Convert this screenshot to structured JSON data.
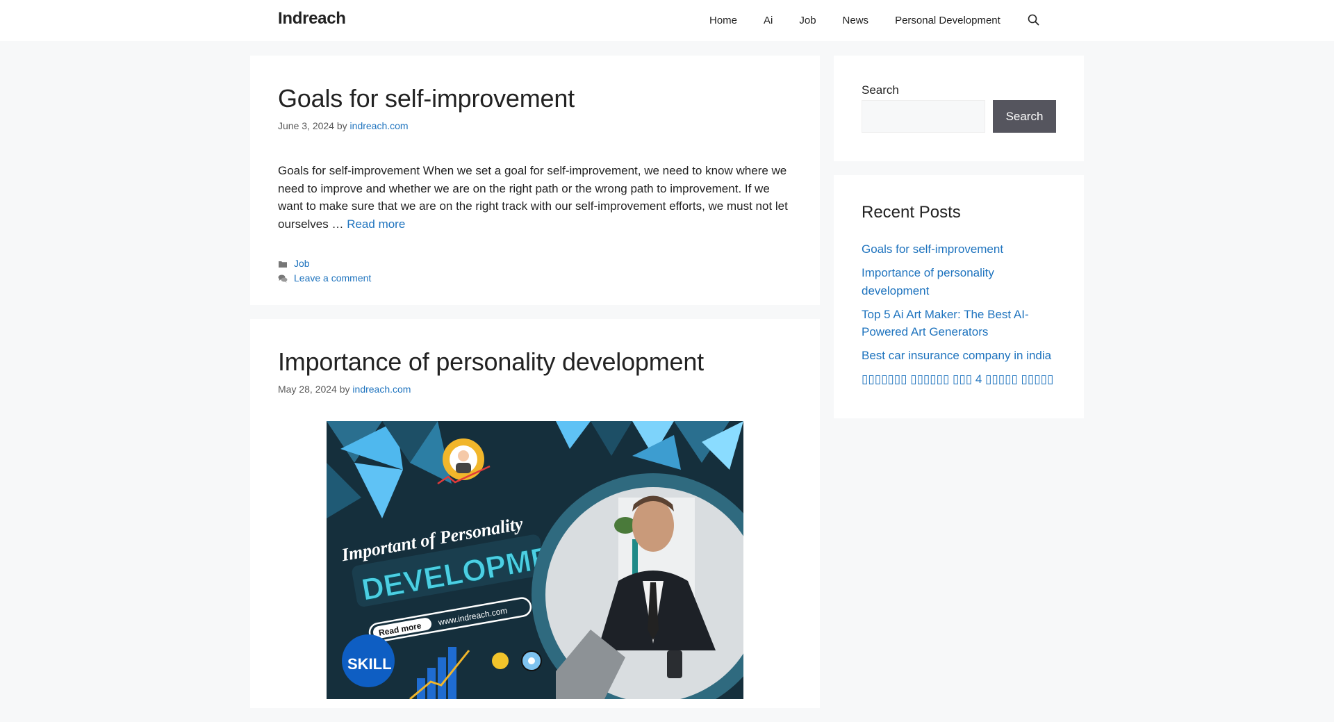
{
  "header": {
    "site_title": "Indreach",
    "nav": [
      "Home",
      "Ai",
      "Job",
      "News",
      "Personal Development"
    ],
    "search_icon": "search-icon"
  },
  "posts": [
    {
      "title": "Goals for self-improvement",
      "date": "June 3, 2024",
      "by": "by",
      "author": "indreach.com",
      "excerpt": "Goals for self-improvement When we set a goal for self-improvement, we need to know where we need to improve and whether we are on the right path or the wrong path to improvement. If we want to make sure that we are on the right track with our self-improvement efforts, we must not let ourselves … ",
      "read_more": "Read more",
      "category_icon": "folder-icon",
      "category": "Job",
      "comment_icon": "comments-icon",
      "comment_link": "Leave a comment"
    },
    {
      "title": "Importance of personality development",
      "date": "May 28, 2024",
      "by": "by",
      "author": "indreach.com",
      "image": {
        "heading": "Important of Personality",
        "headline": "DEVELOPMENT",
        "button": "Read more",
        "url": "www.indreach.com",
        "badge": "SKILL"
      }
    }
  ],
  "sidebar": {
    "search_label": "Search",
    "search_placeholder": "",
    "search_value": "",
    "search_button": "Search",
    "recent_title": "Recent Posts",
    "recent_posts": [
      "Goals for self-improvement",
      "Importance of personality development",
      "Top 5 Ai Art Maker: The Best AI-Powered Art Generators",
      "Best car insurance company in india",
      "▯▯▯▯▯▯▯ ▯▯▯▯▯▯ ▯▯▯ 4 ▯▯▯▯▯ ▯▯▯▯▯"
    ]
  },
  "colors": {
    "link": "#1e73be",
    "button": "#55555e",
    "background": "#f7f8f9"
  }
}
